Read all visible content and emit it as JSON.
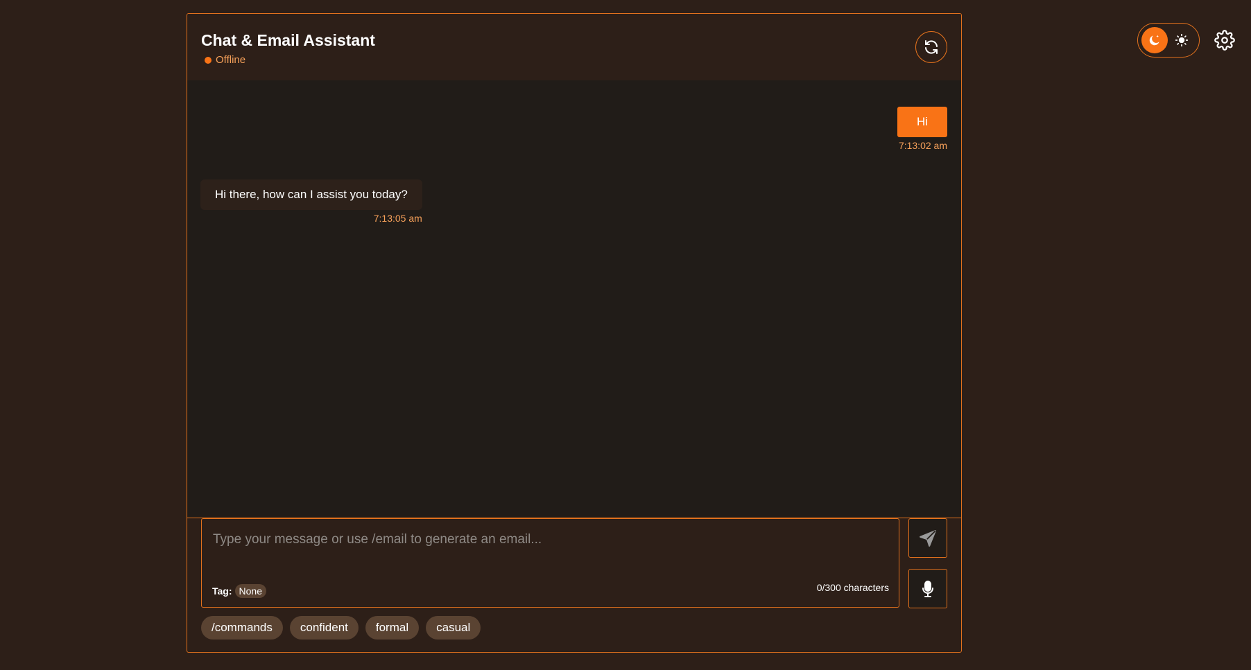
{
  "header": {
    "title": "Chat & Email Assistant",
    "status": "Offline"
  },
  "messages": [
    {
      "role": "user",
      "text": "Hi",
      "time": "7:13:02 am"
    },
    {
      "role": "assistant",
      "text": "Hi there, how can I assist you today?",
      "time": "7:13:05 am"
    }
  ],
  "composer": {
    "placeholder": "Type your message or use /email to generate an email...",
    "value": "",
    "tag_label": "Tag:",
    "tag_value": "None",
    "char_count": "0/300 characters"
  },
  "chips": [
    "/commands",
    "confident",
    "formal",
    "casual"
  ],
  "icons": {
    "refresh": "refresh-icon",
    "send": "send-icon",
    "mic": "mic-icon",
    "moon": "moon-icon",
    "sun": "sun-icon",
    "settings": "gear-icon"
  },
  "theme": {
    "mode": "dark",
    "accent": "#f97316",
    "border": "#e2711d",
    "background": "#2d1f18",
    "messages_background": "#211c18"
  }
}
